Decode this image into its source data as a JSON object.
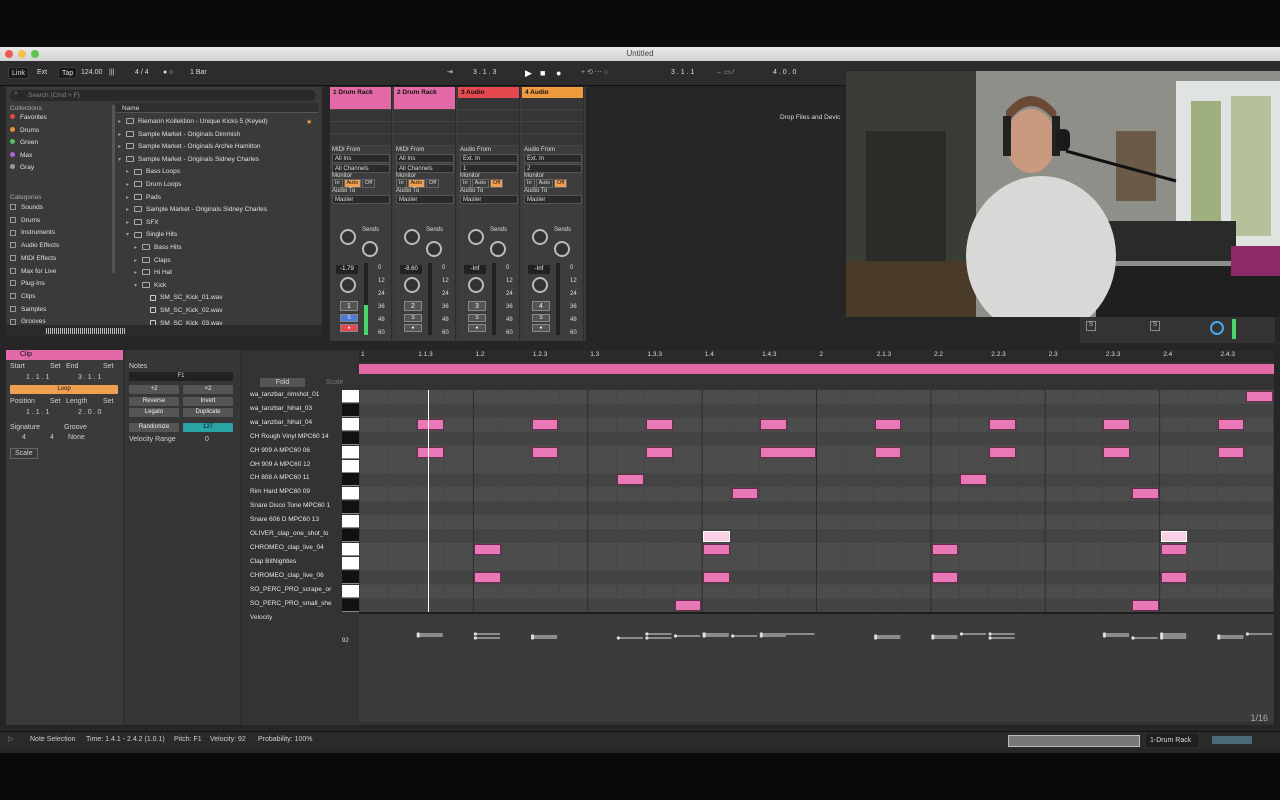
{
  "window": {
    "title": "Untitled"
  },
  "transport": {
    "link": "Link",
    "ext": "Ext",
    "tap": "Tap",
    "tempo": "124.00",
    "signature": "4 / 4",
    "quantize": "1 Bar",
    "arr_pos": "3 .  1 .  3",
    "loop_start": "3 .  1 .  1",
    "loop_len": "4 .  0 .  0"
  },
  "browser": {
    "search_placeholder": "Search (Cmd + F)",
    "collections_header": "Collections",
    "collections": [
      {
        "label": "Favorites",
        "color": "#e04a4a"
      },
      {
        "label": "Drums",
        "color": "#e8902f"
      },
      {
        "label": "Green",
        "color": "#58c25a"
      },
      {
        "label": "Max",
        "color": "#b45ed6"
      },
      {
        "label": "Gray",
        "color": "#9a9a9a"
      }
    ],
    "categories_header": "Categories",
    "categories": [
      "Sounds",
      "Drums",
      "Instruments",
      "Audio Effects",
      "MIDI Effects",
      "Max for Live",
      "Plug-Ins",
      "Clips",
      "Samples",
      "Grooves"
    ],
    "name_header": "Name",
    "items": [
      "Riemann Kollektion - Unique Kicks 5 (Keyed)",
      "Sample Market - Originals Dimmish",
      "Sample Market - Originals Archie Hamilton",
      "Sample Market - Originals Sidney Charles",
      "Bass Loops",
      "Drum Loops",
      "Pads",
      "Sample Market - Originals Sidney Charles",
      "SFX",
      "Single Hits",
      "Bass Hits",
      "Claps",
      "Hi Hat",
      "Kick",
      "SM_SC_Kick_01.wav",
      "SM_SC_Kick_02.wav",
      "SM_SC_Kick_03.wav"
    ]
  },
  "mixer": {
    "tracks": [
      {
        "name": "1 Drum Rack",
        "color": "#e36aa7",
        "from_label": "MIDI From",
        "from": "All Ins",
        "channel": "All Channels",
        "to": "Master",
        "vol": "-1.79",
        "num": "1"
      },
      {
        "name": "2 Drum Rack",
        "color": "#e36aa7",
        "from_label": "MIDI From",
        "from": "All Ins",
        "channel": "All Channels",
        "to": "Master",
        "vol": "-8.60",
        "num": "2"
      },
      {
        "name": "3 Audio",
        "color": "#e6484f",
        "from_label": "Audio From",
        "from": "Ext. In",
        "channel": "1",
        "to": "Master",
        "vol": "-Inf",
        "num": "3"
      },
      {
        "name": "4 Audio",
        "color": "#f09a3e",
        "from_label": "Audio From",
        "from": "Ext. In",
        "channel": "2",
        "to": "Master",
        "vol": "-Inf",
        "num": "4"
      }
    ],
    "monitor_label": "Monitor",
    "mon_in": "In",
    "mon_auto": "Auto",
    "mon_off": "Off",
    "audio_to_label": "Audio To",
    "sends_label": "Sends",
    "scale": [
      "0",
      "12",
      "24",
      "36",
      "48",
      "60"
    ],
    "drop_text": "Drop Files and Devic"
  },
  "clip": {
    "header": "Clip",
    "start_label": "Start",
    "end_label": "End",
    "set_label": "Set",
    "start": "1 .  1 .  1",
    "end": "3 .  1 .  1",
    "loop": "Loop",
    "position_label": "Position",
    "length_label": "Length",
    "position": "1 .  1 .  1",
    "length": "2 .  0 .  0",
    "signature_label": "Signature",
    "groove_label": "Groove",
    "sig_num": "4",
    "sig_den": "4",
    "groove": "None",
    "scale_label": "Scale"
  },
  "notes": {
    "header": "Notes",
    "pitch": "F1",
    "plus2": "+2",
    "times2": "×2",
    "reverse": "Reverse",
    "invert": "Invert",
    "legato": "Legato",
    "duplicate": "Duplicate",
    "randomize": "Randomize",
    "randomize_val": "127",
    "velocity_range": "Velocity Range",
    "velocity_range_val": "0"
  },
  "editor": {
    "fold": "Fold",
    "scale": "Scale",
    "ruler": [
      "1",
      "1.1.3",
      "1.2",
      "1.2.3",
      "1.3",
      "1.3.3",
      "1.4",
      "1.4.3",
      "2",
      "2.1.3",
      "2.2",
      "2.2.3",
      "2.3",
      "2.3.3",
      "2.4",
      "2.4.3"
    ],
    "lanes": [
      "wa_tanzbar_rimshot_01",
      "wa_tanzbar_hihat_03",
      "wa_tanzbar_hihat_04",
      "CH Rough Vinyl MPC60 14",
      "CH 909 A MPC60 06",
      "OH 909 A MPC60 12",
      "CH 808 A MPC60 11",
      "Rim Hard MPC60 09",
      "Snare Disco Tone MPC60 1",
      "Snare 606 D MPC60 13",
      "OLIVER_clap_one_shot_lo",
      "CHROMEO_clap_live_04",
      "Clap BitNighties",
      "CHROMEO_clap_live_06",
      "SO_PERC_PRO_scrape_or",
      "SO_PERC_PRO_small_she"
    ],
    "velocity_label": "Velocity",
    "velocity_value": "92",
    "grid": "1/16"
  },
  "status": {
    "selection": "Note Selection",
    "time": "Time: 1.4.1 - 2.4.2 (1.0.1)",
    "pitch": "Pitch: F1",
    "velocity": "Velocity: 92",
    "probability": "Probability: 100%",
    "track": "1-Drum Rack"
  }
}
